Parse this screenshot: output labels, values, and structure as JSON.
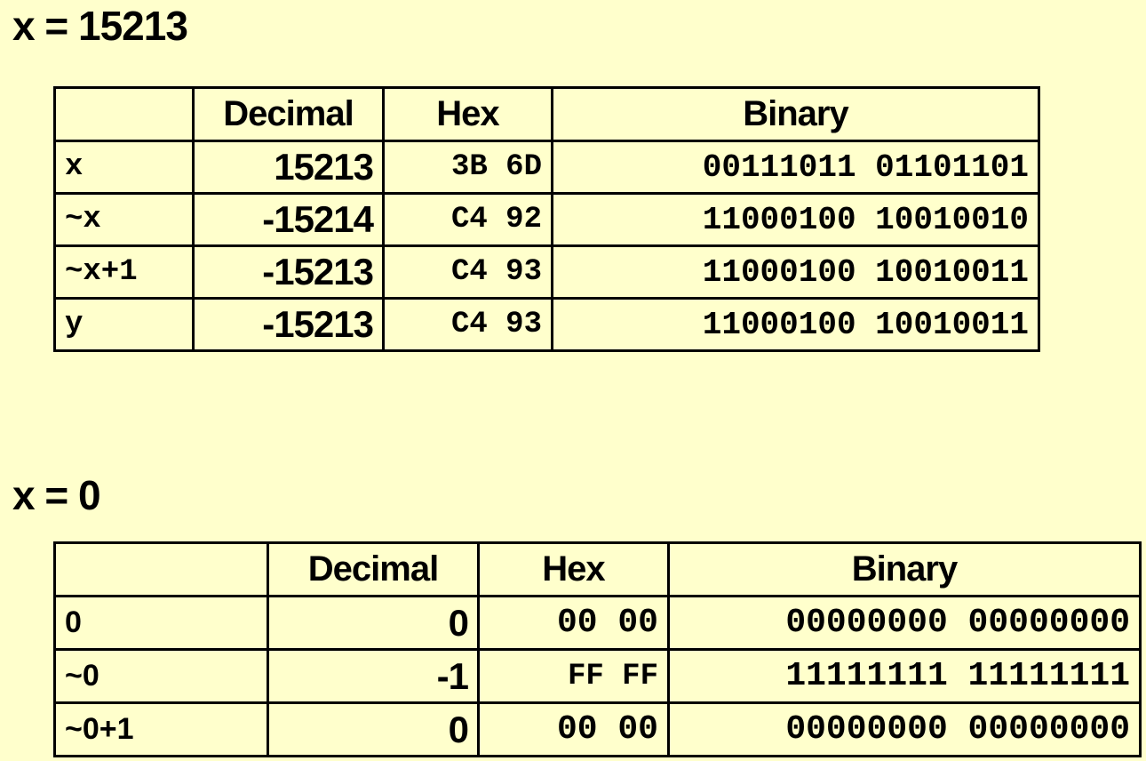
{
  "section1": {
    "heading": "x = 15213",
    "headers": [
      "",
      "Decimal",
      "Hex",
      "Binary"
    ],
    "rows": [
      {
        "label": "x",
        "decimal": "15213",
        "hex": "3B 6D",
        "binary": "00111011 01101101"
      },
      {
        "label": "~x",
        "decimal": "-15214",
        "hex": "C4 92",
        "binary": "11000100 10010010"
      },
      {
        "label": "~x+1",
        "decimal": "-15213",
        "hex": "C4 93",
        "binary": "11000100 10010011"
      },
      {
        "label": "y",
        "decimal": "-15213",
        "hex": "C4 93",
        "binary": "11000100 10010011"
      }
    ]
  },
  "section2": {
    "heading": "x = 0",
    "headers": [
      "",
      "Decimal",
      "Hex",
      "Binary"
    ],
    "rows": [
      {
        "label": "0",
        "decimal": "0",
        "hex": "00 00",
        "binary": "00000000 00000000"
      },
      {
        "label": "~0",
        "decimal": "-1",
        "hex": "FF FF",
        "binary": "11111111 11111111"
      },
      {
        "label": "~0+1",
        "decimal": "0",
        "hex": "00 00",
        "binary": "00000000 00000000"
      }
    ]
  },
  "colors": {
    "background": "#ffffcc",
    "text": "#000000",
    "border": "#000000"
  }
}
